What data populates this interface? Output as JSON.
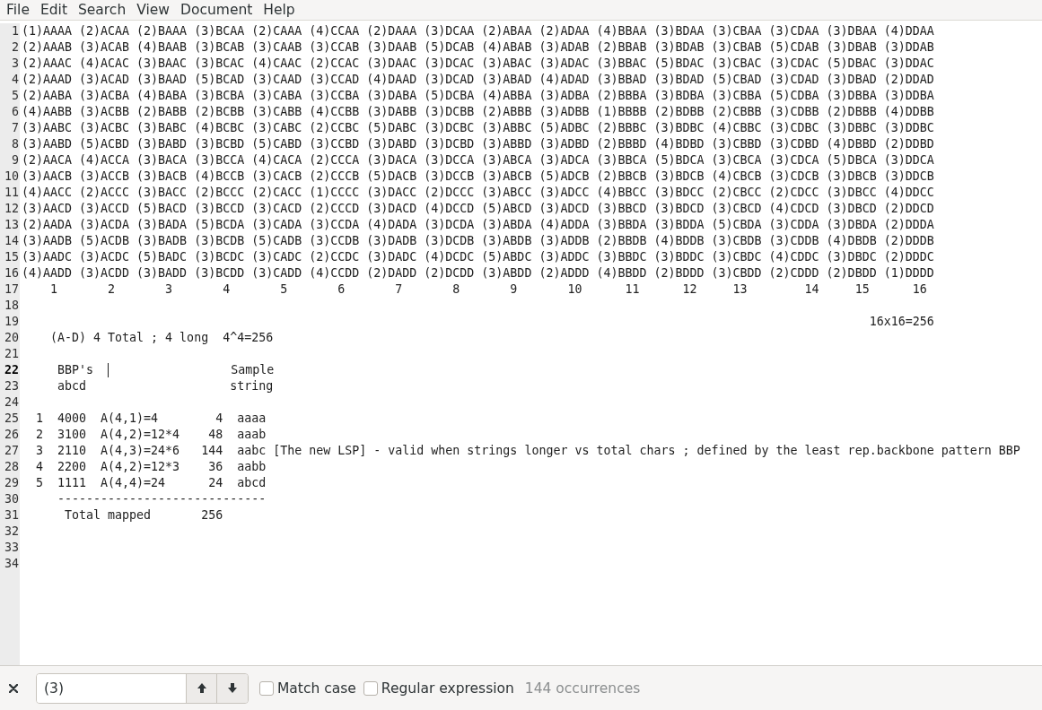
{
  "menu": [
    "File",
    "Edit",
    "Search",
    "View",
    "Document",
    "Help"
  ],
  "lines": [
    {
      "number": "1",
      "current": false,
      "text": "(1)AAAA (2)ACAA (2)BAAA (3)BCAA (2)CAAA (4)CCAA (2)DAAA (3)DCAA (2)ABAA (2)ADAA (4)BBAA (3)BDAA (3)CBAA (3)CDAA (3)DBAA (4)DDAA"
    },
    {
      "number": "2",
      "current": false,
      "text": "(2)AAAB (3)ACAB (4)BAAB (3)BCAB (3)CAAB (3)CCAB (3)DAAB (5)DCAB (4)ABAB (3)ADAB (2)BBAB (3)BDAB (3)CBAB (5)CDAB (3)DBAB (3)DDAB"
    },
    {
      "number": "3",
      "current": false,
      "text": "(2)AAAC (4)ACAC (3)BAAC (3)BCAC (4)CAAC (2)CCAC (3)DAAC (3)DCAC (3)ABAC (3)ADAC (3)BBAC (5)BDAC (3)CBAC (3)CDAC (5)DBAC (3)DDAC"
    },
    {
      "number": "4",
      "current": false,
      "text": "(2)AAAD (3)ACAD (3)BAAD (5)BCAD (3)CAAD (3)CCAD (4)DAAD (3)DCAD (3)ABAD (4)ADAD (3)BBAD (3)BDAD (5)CBAD (3)CDAD (3)DBAD (2)DDAD"
    },
    {
      "number": "5",
      "current": false,
      "text": "(2)AABA (3)ACBA (4)BABA (3)BCBA (3)CABA (3)CCBA (3)DABA (5)DCBA (4)ABBA (3)ADBA (2)BBBA (3)BDBA (3)CBBA (5)CDBA (3)DBBA (3)DDBA"
    },
    {
      "number": "6",
      "current": false,
      "text": "(4)AABB (3)ACBB (2)BABB (2)BCBB (3)CABB (4)CCBB (3)DABB (3)DCBB (2)ABBB (3)ADBB (1)BBBB (2)BDBB (2)CBBB (3)CDBB (2)DBBB (4)DDBB"
    },
    {
      "number": "7",
      "current": false,
      "text": "(3)AABC (3)ACBC (3)BABC (4)BCBC (3)CABC (2)CCBC (5)DABC (3)DCBC (3)ABBC (5)ADBC (2)BBBC (3)BDBC (4)CBBC (3)CDBC (3)DBBC (3)DDBC"
    },
    {
      "number": "8",
      "current": false,
      "text": "(3)AABD (5)ACBD (3)BABD (3)BCBD (5)CABD (3)CCBD (3)DABD (3)DCBD (3)ABBD (3)ADBD (2)BBBD (4)BDBD (3)CBBD (3)CDBD (4)DBBD (2)DDBD"
    },
    {
      "number": "9",
      "current": false,
      "text": "(2)AACA (4)ACCA (3)BACA (3)BCCA (4)CACA (2)CCCA (3)DACA (3)DCCA (3)ABCA (3)ADCA (3)BBCA (5)BDCA (3)CBCA (3)CDCA (5)DBCA (3)DDCA"
    },
    {
      "number": "10",
      "current": false,
      "text": "(3)AACB (3)ACCB (3)BACB (4)BCCB (3)CACB (2)CCCB (5)DACB (3)DCCB (3)ABCB (5)ADCB (2)BBCB (3)BDCB (4)CBCB (3)CDCB (3)DBCB (3)DDCB"
    },
    {
      "number": "11",
      "current": false,
      "text": "(4)AACC (2)ACCC (3)BACC (2)BCCC (2)CACC (1)CCCC (3)DACC (2)DCCC (3)ABCC (3)ADCC (4)BBCC (3)BDCC (2)CBCC (2)CDCC (3)DBCC (4)DDCC"
    },
    {
      "number": "12",
      "current": false,
      "text": "(3)AACD (3)ACCD (5)BACD (3)BCCD (3)CACD (2)CCCD (3)DACD (4)DCCD (5)ABCD (3)ADCD (3)BBCD (3)BDCD (3)CBCD (4)CDCD (3)DBCD (2)DDCD"
    },
    {
      "number": "13",
      "current": false,
      "text": "(2)AADA (3)ACDA (3)BADA (5)BCDA (3)CADA (3)CCDA (4)DADA (3)DCDA (3)ABDA (4)ADDA (3)BBDA (3)BDDA (5)CBDA (3)CDDA (3)DBDA (2)DDDA"
    },
    {
      "number": "14",
      "current": false,
      "text": "(3)AADB (5)ACDB (3)BADB (3)BCDB (5)CADB (3)CCDB (3)DADB (3)DCDB (3)ABDB (3)ADDB (2)BBDB (4)BDDB (3)CBDB (3)CDDB (4)DBDB (2)DDDB"
    },
    {
      "number": "15",
      "current": false,
      "text": "(3)AADC (3)ACDC (5)BADC (3)BCDC (3)CADC (2)CCDC (3)DADC (4)DCDC (5)ABDC (3)ADDC (3)BBDC (3)BDDC (3)CBDC (4)CDDC (3)DBDC (2)DDDC"
    },
    {
      "number": "16",
      "current": false,
      "text": "(4)AADD (3)ACDD (3)BADD (3)BCDD (3)CADD (4)CCDD (2)DADD (2)DCDD (3)ABDD (2)ADDD (4)BBDD (2)BDDD (3)CBDD (2)CDDD (2)DBDD (1)DDDD"
    },
    {
      "number": "17",
      "current": false,
      "text": "    1       2       3       4       5       6       7       8       9       10      11      12     13        14     15      16"
    },
    {
      "number": "18",
      "current": false
    },
    {
      "number": "19",
      "current": false,
      "text": "                                                                                                                      16x16=256"
    },
    {
      "number": "20",
      "current": false,
      "text": "    (A-D) 4 Total ; 4 long  4^4=256"
    },
    {
      "number": "21",
      "current": false
    },
    {
      "number": "22",
      "current": true,
      "text": "     BBP's  ",
      "text_after_cursor": "                 Sample"
    },
    {
      "number": "23",
      "current": false,
      "text": "     abcd                    string"
    },
    {
      "number": "24",
      "current": false
    },
    {
      "number": "25",
      "current": false,
      "text": "  1  4000  A(4,1)=4        4  aaaa"
    },
    {
      "number": "26",
      "current": false,
      "text": "  2  3100  A(4,2)=12*4    48  aaab"
    },
    {
      "number": "27",
      "current": false,
      "text": "  3  2110  A(4,3)=24*6   144  aabc [The new LSP] - valid when strings longer vs total chars ; defined by the least rep.backbone pattern BBP"
    },
    {
      "number": "28",
      "current": false,
      "text": "  4  2200  A(4,2)=12*3    36  aabb"
    },
    {
      "number": "29",
      "current": false,
      "text": "  5  1111  A(4,4)=24      24  abcd"
    },
    {
      "number": "30",
      "current": false,
      "text": "     -----------------------------"
    },
    {
      "number": "31",
      "current": false,
      "text": "      Total mapped       256"
    },
    {
      "number": "32",
      "current": false
    },
    {
      "number": "33",
      "current": false
    },
    {
      "number": "34",
      "current": false
    }
  ],
  "find_bar": {
    "value": "(3)",
    "options": [
      {
        "label": "Match case",
        "checked": false
      },
      {
        "label": "Regular expression",
        "checked": false
      }
    ],
    "result": "144 occurrences"
  }
}
